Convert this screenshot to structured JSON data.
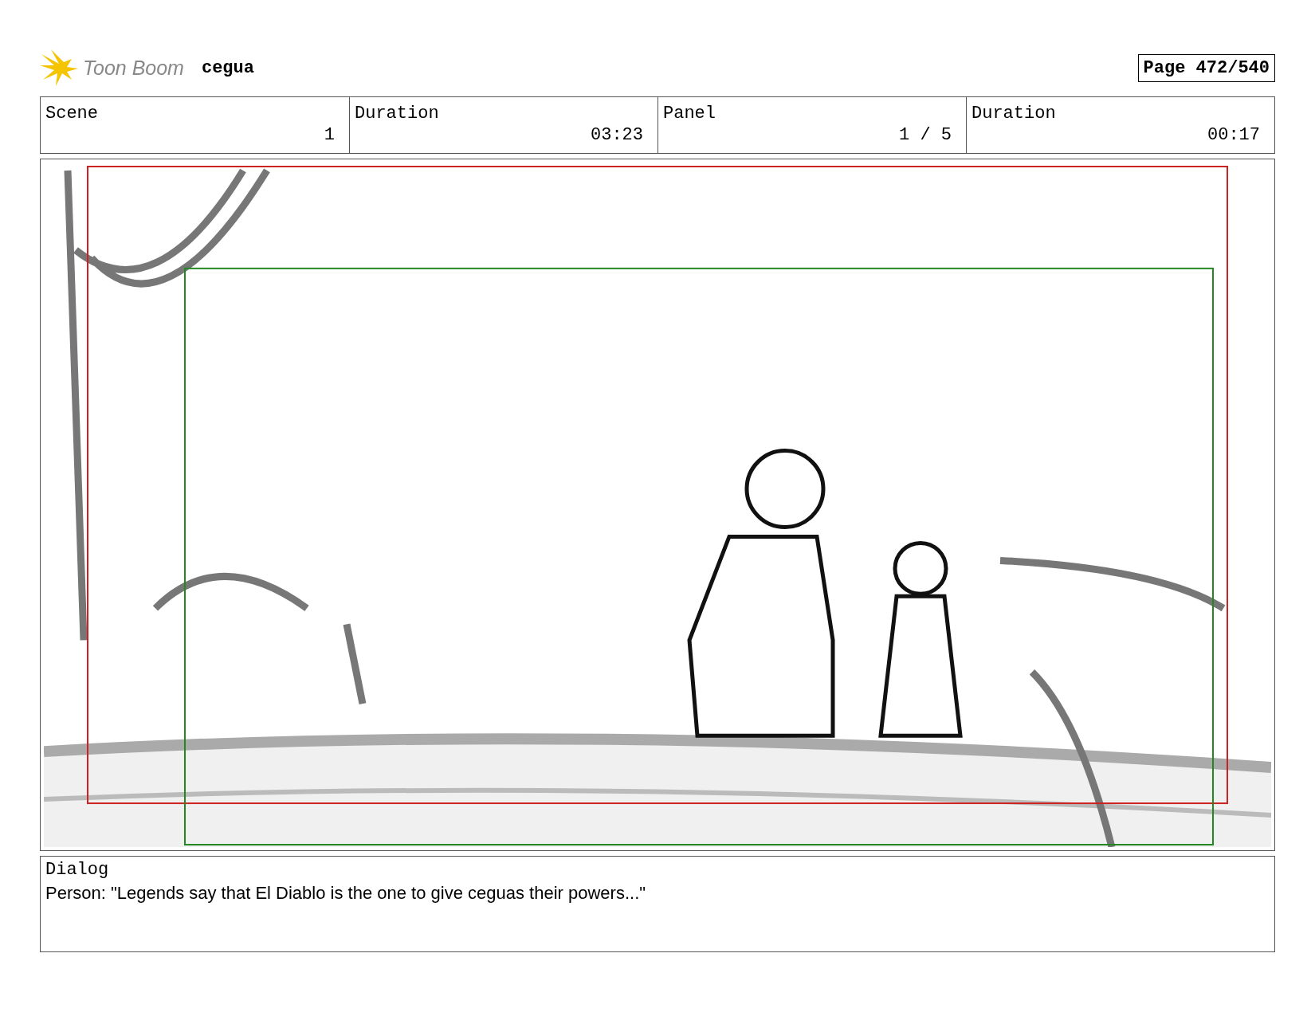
{
  "header": {
    "logo_text": "Toon Boom",
    "project": "cegua",
    "page": "Page 472/540"
  },
  "info": [
    {
      "label": "Scene",
      "value": "1"
    },
    {
      "label": "Duration",
      "value": "03:23"
    },
    {
      "label": "Panel",
      "value": "1 / 5"
    },
    {
      "label": "Duration",
      "value": "00:17"
    }
  ],
  "dialog": {
    "label": "Dialog",
    "text": "Person: \"Legends say that El Diablo is the one to give ceguas their powers...\""
  }
}
